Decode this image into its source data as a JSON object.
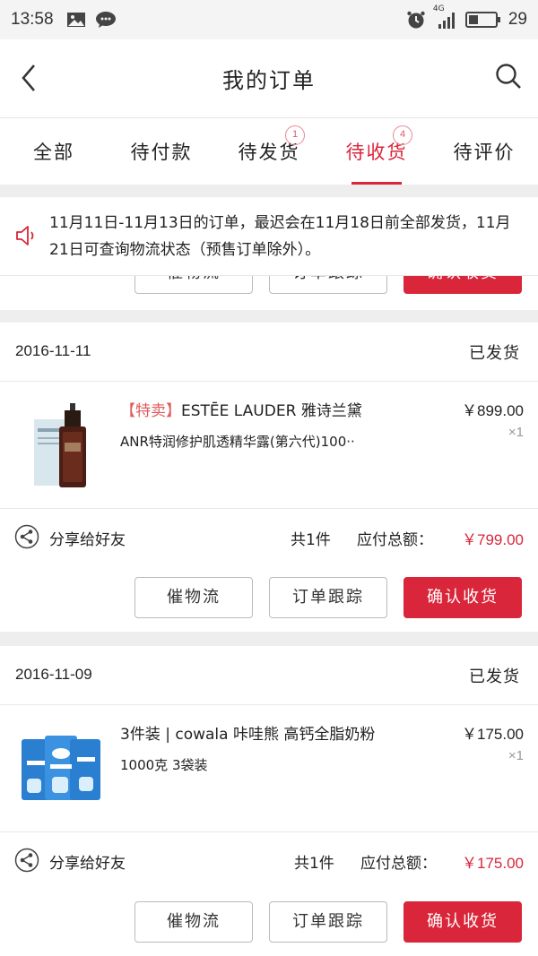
{
  "status_bar": {
    "time": "13:58",
    "network": "4G",
    "battery": "29"
  },
  "header": {
    "title": "我的订单"
  },
  "tabs": [
    {
      "label": "全部",
      "badge": ""
    },
    {
      "label": "待付款",
      "badge": ""
    },
    {
      "label": "待发货",
      "badge": "1"
    },
    {
      "label": "待收货",
      "badge": "4",
      "active": true
    },
    {
      "label": "待评价",
      "badge": ""
    }
  ],
  "notice": {
    "text": "11月11日-11月13日的订单，最迟会在11月18日前全部发货，11月21日可查询物流状态（预售订单除外）。"
  },
  "buttons": {
    "logistics": "催物流",
    "track": "订单跟踪",
    "confirm": "确认收货"
  },
  "orders": [
    {
      "date": "2016-11-11",
      "status": "已发货",
      "product": {
        "tag": "【特卖】",
        "name_line1": "ESTĒE LAUDER 雅诗兰黛",
        "name_line2": "ANR特润修护肌透精华露(第六代)100··",
        "price": "￥899.00",
        "qty": "×1"
      },
      "summary": {
        "share": "分享给好友",
        "count": "共1件",
        "due_label": "应付总额：",
        "due": "￥799.00"
      }
    },
    {
      "date": "2016-11-09",
      "status": "已发货",
      "product": {
        "tag": "",
        "name_line1": "3件装 | cowala 咔哇熊 高钙全脂奶粉",
        "name_line2": "1000克 3袋装",
        "price": "￥175.00",
        "qty": "×1"
      },
      "summary": {
        "share": "分享给好友",
        "count": "共1件",
        "due_label": "应付总额：",
        "due": "￥175.00"
      }
    }
  ],
  "colors": {
    "accent": "#d9263a",
    "badge": "#e05868",
    "tag": "#e15a5a"
  }
}
